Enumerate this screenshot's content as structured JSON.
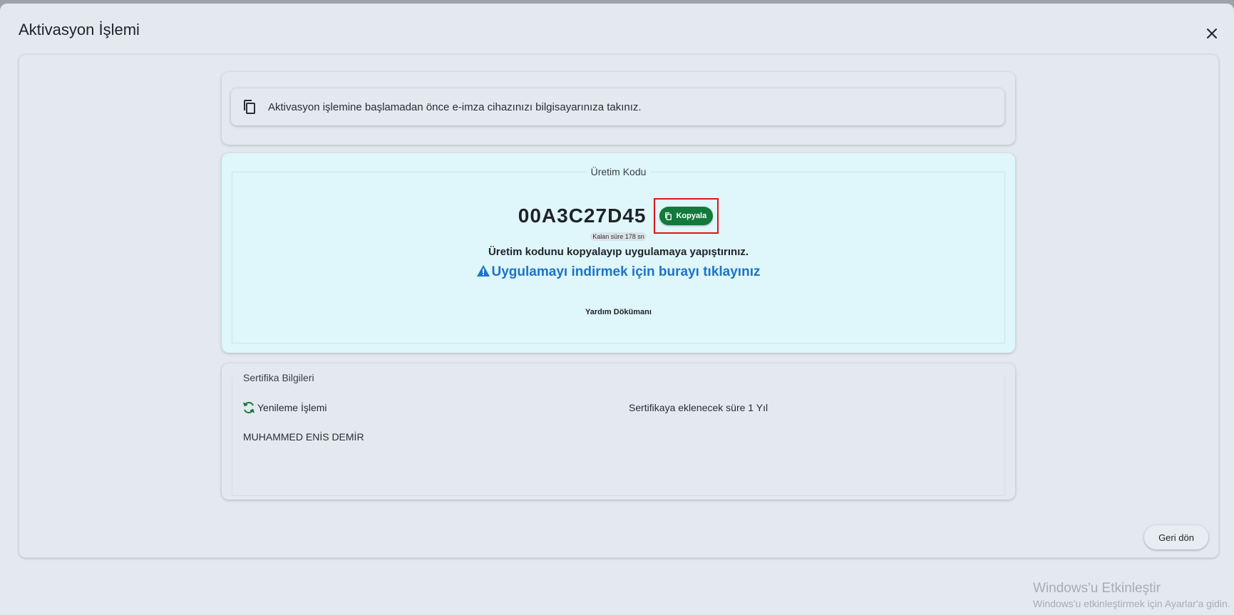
{
  "dialog": {
    "title": "Aktivasyon İşlemi",
    "close_icon": "close-icon"
  },
  "info": {
    "icon": "copy-icon",
    "text": "Aktivasyon işlemine başlamadan önce e-imza cihazınızı bilgisayarınıza takınız."
  },
  "production_code": {
    "legend": "Üretim Kodu",
    "code": "00A3C27D45",
    "copy_label": "Kopyala",
    "timer": "Kalan süre 178 sn",
    "instruction": "Üretim kodunu kopyalayıp uygulamaya yapıştırınız.",
    "download_link": "Uygulamayı indirmek için burayı tıklayınız",
    "help_doc": "Yardım Dökümanı",
    "colors": {
      "copy_button": "#137a3c",
      "link": "#1b74c8",
      "highlight": "#e0141c"
    }
  },
  "certificate": {
    "title": "Sertifika Bilgileri",
    "renewal_label": "Yenileme İşlemi",
    "duration_text": "Sertifikaya eklenecek süre 1 Yıl",
    "owner_name": "MUHAMMED ENİS DEMİR"
  },
  "footer": {
    "back_label": "Geri dön"
  },
  "watermark": {
    "title": "Windows'u Etkinleştir",
    "subtitle": "Windows'u etkinleştirmek için Ayarlar'a gidin."
  }
}
